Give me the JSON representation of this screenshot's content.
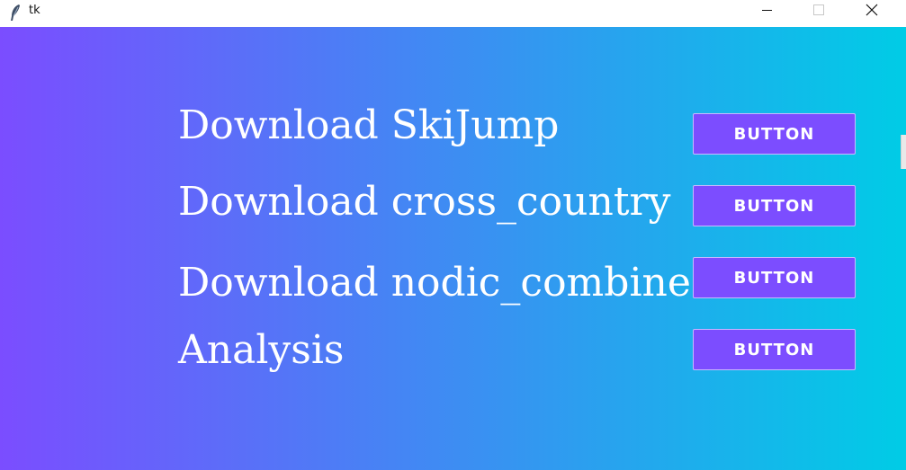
{
  "window": {
    "title": "tk"
  },
  "theme": {
    "gradient_start": "#7b4dff",
    "gradient_end": "#00cce6",
    "button_color": "#7c4dff",
    "text_color": "#ffffff"
  },
  "rows": [
    {
      "label": "Download SkiJump",
      "button_label": "BUTTON"
    },
    {
      "label": "Download cross_country",
      "button_label": "BUTTON"
    },
    {
      "label": "Download nodic_combined",
      "button_label": "BUTTON"
    },
    {
      "label": "Analysis",
      "button_label": "BUTTON"
    }
  ],
  "icons": {
    "app": "feather-icon",
    "minimize": "minimize-icon",
    "maximize": "maximize-icon",
    "close": "close-icon"
  }
}
